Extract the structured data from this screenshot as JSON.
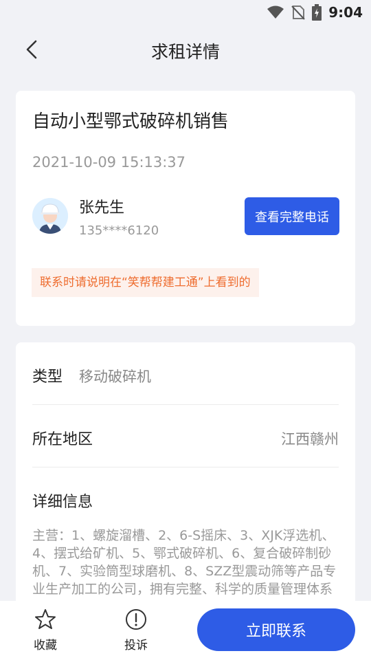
{
  "status_bar": {
    "time": "9:04"
  },
  "header": {
    "title": "求租详情"
  },
  "listing": {
    "title": "自动小型鄂式破碎机销售",
    "datetime": "2021-10-09 15:13:37",
    "contact_name": "张先生",
    "contact_phone": "135****6120",
    "view_phone_label": "查看完整电话",
    "notice": "联系时请说明在“笑帮帮建工通”上看到的"
  },
  "details": {
    "type_label": "类型",
    "type_value": "移动破碎机",
    "region_label": "所在地区",
    "region_value": "江西赣州",
    "info_label": "详细信息",
    "info_text": "主营：1、螺旋溜槽、2、6-S摇床、3、XJK浮选机、4、摆式给矿机、5、鄂式破碎机、6、复合破碎制砂机、7、实验筒型球磨机、8、SZZ型震动筛等产品专业生产加工的公司，拥有完整、科学的质量管理体系"
  },
  "bottom_bar": {
    "favorite_label": "收藏",
    "report_label": "投诉",
    "contact_label": "立即联系"
  },
  "colors": {
    "accent": "#2e5ce6",
    "notice_text": "#ee6c2e",
    "notice_bg": "#fdf1ec"
  },
  "icons": [
    "wifi-icon",
    "no-sim-icon",
    "battery-charging-icon",
    "back-arrow-icon",
    "star-icon",
    "exclamation-circle-icon"
  ]
}
